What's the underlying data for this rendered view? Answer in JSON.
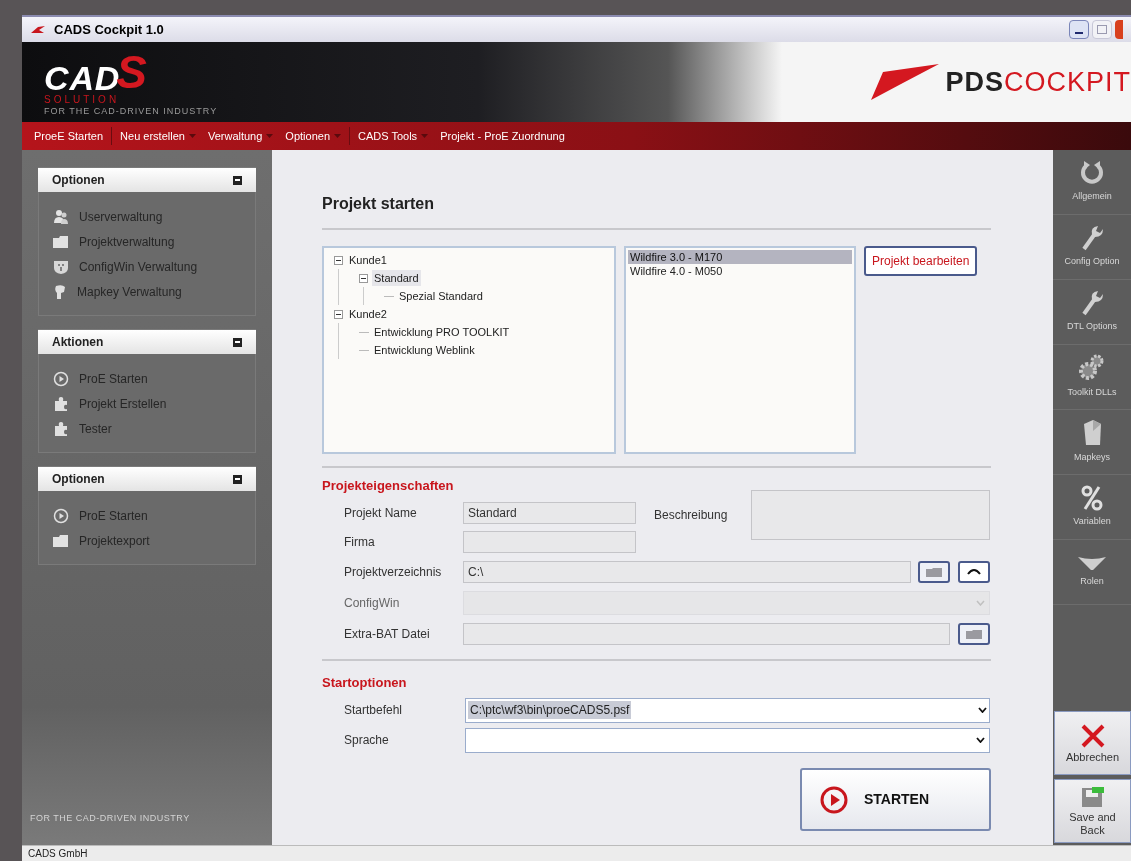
{
  "window": {
    "title": "CADS Cockpit 1.0"
  },
  "banner": {
    "logo_main": "CAD",
    "logo_accent": "S",
    "logo_sub": "SOLUTION",
    "tagline": "FOR THE CAD-DRIVEN INDUSTRY",
    "product_dark": "PDS",
    "product_accent": "COCKPIT"
  },
  "menu": [
    {
      "label": "ProeE Starten",
      "has_dropdown": false
    },
    {
      "label": "Neu erstellen",
      "has_dropdown": true
    },
    {
      "label": "Verwaltung",
      "has_dropdown": true
    },
    {
      "label": "Optionen",
      "has_dropdown": true
    },
    {
      "label": "CADS Tools",
      "has_dropdown": true
    },
    {
      "label": "Projekt - ProE Zuordnung",
      "has_dropdown": false
    }
  ],
  "sidebar": {
    "panels": [
      {
        "title": "Optionen",
        "items": [
          {
            "label": "Userverwaltung",
            "kind": "users"
          },
          {
            "label": "Projektverwaltung",
            "kind": "folder"
          },
          {
            "label": "ConfigWin Verwaltung",
            "kind": "shield"
          },
          {
            "label": "Mapkey Verwaltung",
            "kind": "key"
          }
        ]
      },
      {
        "title": "Aktionen",
        "items": [
          {
            "label": "ProE Starten",
            "kind": "play"
          },
          {
            "label": "Projekt Erstellen",
            "kind": "puzzle"
          },
          {
            "label": "Tester",
            "kind": "puzzle"
          }
        ]
      },
      {
        "title": "Optionen",
        "items": [
          {
            "label": "ProE Starten",
            "kind": "play"
          },
          {
            "label": "Projektexport",
            "kind": "folder"
          }
        ]
      }
    ],
    "footer": "FOR THE CAD-DRIVEN INDUSTRY"
  },
  "main": {
    "title": "Projekt starten",
    "tree": [
      {
        "label": "Kunde1",
        "expanded": true,
        "selected": false,
        "children": [
          {
            "label": "Standard",
            "expanded": true,
            "selected": true,
            "children": [
              {
                "label": "Spezial Standard",
                "selected": false
              }
            ]
          }
        ]
      },
      {
        "label": "Kunde2",
        "expanded": true,
        "selected": false,
        "children": [
          {
            "label": "Entwicklung PRO TOOLKIT",
            "selected": false
          },
          {
            "label": "Entwicklung Weblink",
            "selected": false
          }
        ]
      }
    ],
    "versions": [
      {
        "label": "Wildfire 3.0 - M170",
        "selected": true
      },
      {
        "label": "Wildfire 4.0 - M050",
        "selected": false
      }
    ],
    "edit_button": "Projekt bearbeiten",
    "properties_title": "Projekteigenschaften",
    "project_name": {
      "label": "Projekt Name",
      "value": "Standard"
    },
    "description": {
      "label": "Beschreibung"
    },
    "company": {
      "label": "Firma"
    },
    "directory": {
      "label": "Projektverzeichnis",
      "value": "C:\\"
    },
    "configwin": {
      "label": "ConfigWin",
      "disabled": true
    },
    "extra_bat": {
      "label": "Extra-BAT Datei"
    },
    "start_title": "Startoptionen",
    "start_command": {
      "label": "Startbefehl",
      "value": "C:\\ptc\\wf3\\bin\\proeCADS5.psf"
    },
    "language": {
      "label": "Sprache"
    },
    "start_button": "STARTEN"
  },
  "right_panel": [
    {
      "label": "Allgemein",
      "kind": "refresh"
    },
    {
      "label": "Config Option",
      "kind": "wrench"
    },
    {
      "label": "DTL Options",
      "kind": "wrench"
    },
    {
      "label": "Toolkit DLLs",
      "kind": "gears"
    },
    {
      "label": "Mapkeys",
      "kind": "block"
    },
    {
      "label": "Variablen",
      "kind": "percent"
    },
    {
      "label": "Rolen",
      "kind": "funnel"
    }
  ],
  "actions": [
    {
      "label": "Abbrechen",
      "kind": "cross"
    },
    {
      "label": "Save and Back",
      "kind": "save"
    }
  ],
  "status_bar": "CADS GmbH"
}
